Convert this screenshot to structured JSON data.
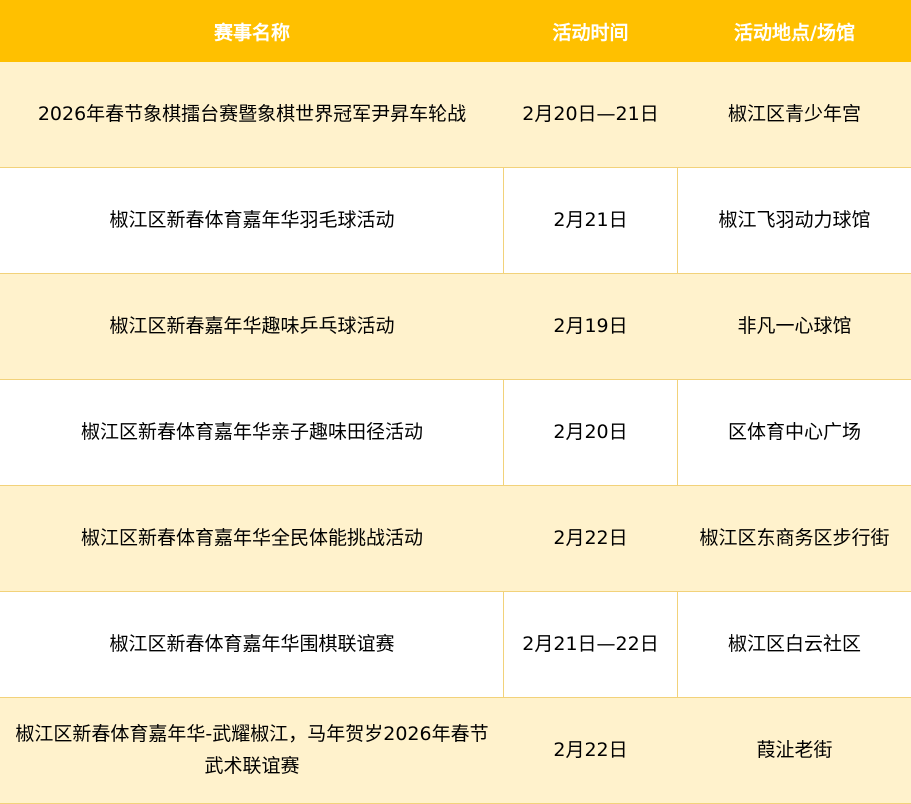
{
  "table": {
    "headers": [
      "赛事名称",
      "活动时间",
      "活动地点/场馆"
    ],
    "rows": [
      [
        "2026年春节象棋擂台赛暨象棋世界冠军尹昇车轮战",
        "2月20日—21日",
        "椒江区青少年宫"
      ],
      [
        "椒江区新春体育嘉年华羽毛球活动",
        "2月21日",
        "椒江飞羽动力球馆"
      ],
      [
        "椒江区新春嘉年华趣味乒乓球活动",
        "2月19日",
        "非凡一心球馆"
      ],
      [
        "椒江区新春体育嘉年华亲子趣味田径活动",
        "2月20日",
        "区体育中心广场"
      ],
      [
        "椒江区新春体育嘉年华全民体能挑战活动",
        "2月22日",
        "椒江区东商务区步行街"
      ],
      [
        "椒江区新春体育嘉年华围棋联谊赛",
        "2月21日—22日",
        "椒江区白云社区"
      ],
      [
        "椒江区新春体育嘉年华-武耀椒江，马年贺岁2026年春节武术联谊赛",
        "2月22日",
        "葭沚老街"
      ]
    ]
  },
  "colors": {
    "header_bg": "#FFC000",
    "header_text": "#FFFFFF",
    "band_bg": "#FFF2CC",
    "plain_bg": "#FFFFFF",
    "grid_line": "#F2D27A"
  }
}
